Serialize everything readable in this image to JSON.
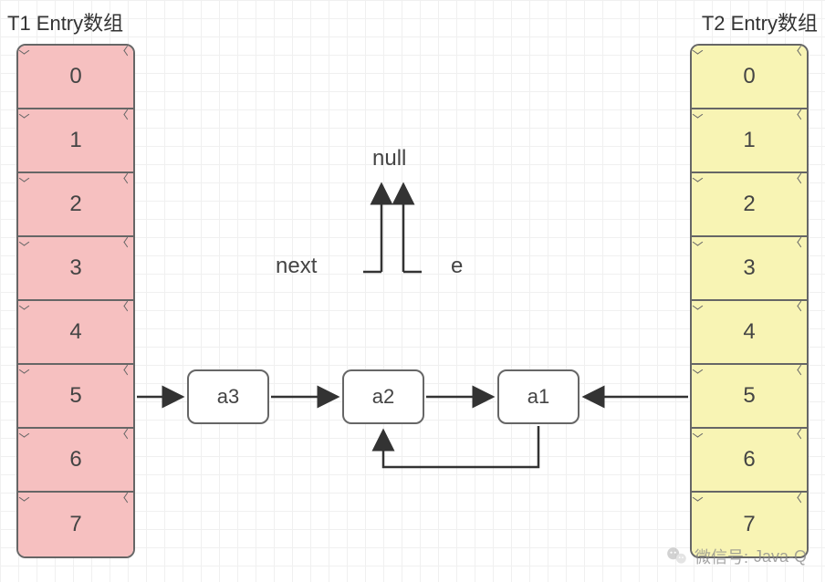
{
  "titles": {
    "t1": "T1 Entry数组",
    "t2": "T2 Entry数组"
  },
  "arrays": {
    "t1": [
      "0",
      "1",
      "2",
      "3",
      "4",
      "5",
      "6",
      "7"
    ],
    "t2": [
      "0",
      "1",
      "2",
      "3",
      "4",
      "5",
      "6",
      "7"
    ]
  },
  "nodes": {
    "a3": "a3",
    "a2": "a2",
    "a1": "a1"
  },
  "labels": {
    "null": "null",
    "next": "next",
    "e": "e"
  },
  "watermark": {
    "prefix": "微信号:",
    "id": "Java-Q"
  },
  "colors": {
    "t1_fill": "#f6c0c0",
    "t2_fill": "#f8f4b4",
    "stroke": "#666"
  }
}
